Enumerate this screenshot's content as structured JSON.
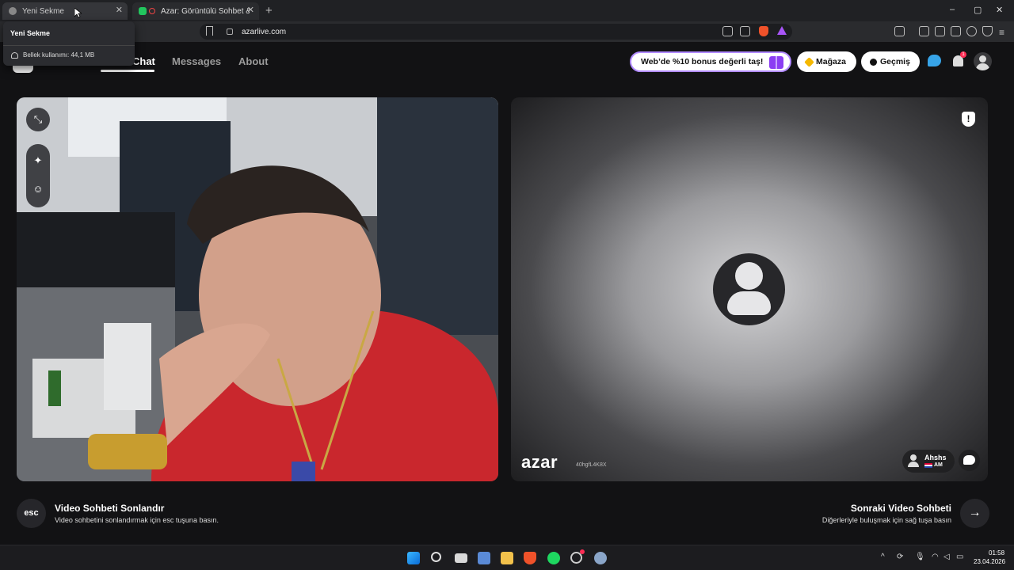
{
  "browser": {
    "tabs": [
      {
        "label": "Yeni Sekme",
        "active": true
      },
      {
        "label": "Azar: Görüntülü Sohbet & Ye",
        "active": false
      }
    ],
    "new_tab": "+",
    "url": "azarlive.com",
    "window_controls": {
      "minimize": "–",
      "maximize": "▢",
      "close": "✕"
    },
    "tab_close": "✕"
  },
  "tooltip": {
    "title": "Yeni Sekme",
    "memory": "Bellek kullanımı: 44,1 MB"
  },
  "site": {
    "nav": {
      "chat": "Chat",
      "messages": "Messages",
      "about": "About"
    },
    "bonus_label": "Web’de %10 bonus değerli taş!",
    "store_label": "Mağaza",
    "history_label": "Geçmiş",
    "notification_count": "1"
  },
  "remote": {
    "logo": "azar",
    "session_id": "40hgfL4K8X",
    "user_name": "Ahshs",
    "country": "AM",
    "report_icon": "!"
  },
  "footer": {
    "esc_key": "esc",
    "end_title": "Video Sohbeti Sonlandır",
    "end_sub": "Video sohbetini sonlandırmak için esc tuşuna basın.",
    "next_title": "Sonraki Video Sohbeti",
    "next_sub": "Diğerleriyle buluşmak için sağ tuşa basın",
    "next_arrow": "→"
  },
  "taskbar": {
    "time": "01:58",
    "date": "23.04.2026"
  },
  "colors": {
    "accent_purple": "#8b3df3",
    "badge_red": "#ff2d55",
    "bubble_blue": "#37a4e8"
  }
}
